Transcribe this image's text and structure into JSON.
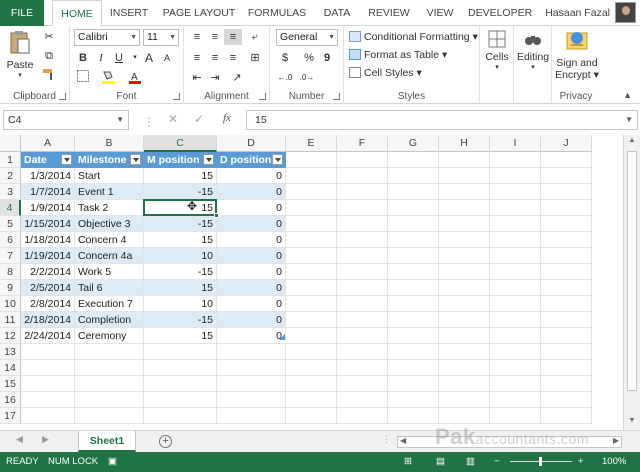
{
  "ribbon_tabs": [
    "FILE",
    "HOME",
    "INSERT",
    "PAGE LAYOUT",
    "FORMULAS",
    "DATA",
    "REVIEW",
    "VIEW",
    "DEVELOPER"
  ],
  "active_tab": "HOME",
  "user_name": "Hasaan Fazal",
  "clipboard": {
    "paste_label": "Paste",
    "group_label": "Clipboard"
  },
  "font": {
    "name": "Calibri",
    "size": "11",
    "group_label": "Font",
    "bold": "B",
    "italic": "I",
    "underline": "U",
    "grow": "A",
    "shrink": "A"
  },
  "alignment": {
    "group_label": "Alignment"
  },
  "number": {
    "format": "General",
    "currency": "$",
    "percent": "%",
    "comma": "9",
    "group_label": "Number"
  },
  "styles": {
    "conditional": "Conditional Formatting",
    "table": "Format as Table",
    "cell_styles": "Cell Styles",
    "group_label": "Styles"
  },
  "cells_label": "Cells",
  "editing_label": "Editing",
  "privacy": {
    "sign_label": "Sign and",
    "encrypt_label": "Encrypt",
    "group_label": "Privacy"
  },
  "name_box": "C4",
  "formula_value": "15",
  "fx_label": "fx",
  "columns": [
    "A",
    "B",
    "C",
    "D",
    "E",
    "F",
    "G",
    "H",
    "I",
    "J"
  ],
  "selected_column": "C",
  "row_numbers": [
    "1",
    "2",
    "3",
    "4",
    "5",
    "6",
    "7",
    "8",
    "9",
    "10",
    "11",
    "12",
    "13",
    "14",
    "15",
    "16",
    "17"
  ],
  "selected_row": "4",
  "table": {
    "headers": [
      "Date",
      "Milestone",
      "M position",
      "D position"
    ],
    "rows": [
      [
        "1/3/2014",
        "Start",
        "15",
        "0"
      ],
      [
        "1/7/2014",
        "Event 1",
        "-15",
        "0"
      ],
      [
        "1/9/2014",
        "Task 2",
        "15",
        "0"
      ],
      [
        "1/15/2014",
        "Objective 3",
        "-15",
        "0"
      ],
      [
        "1/18/2014",
        "Concern 4",
        "15",
        "0"
      ],
      [
        "1/19/2014",
        "Concern 4a",
        "10",
        "0"
      ],
      [
        "2/2/2014",
        "Work 5",
        "-15",
        "0"
      ],
      [
        "2/5/2014",
        "Tail 6",
        "15",
        "0"
      ],
      [
        "2/8/2014",
        "Execution 7",
        "10",
        "0"
      ],
      [
        "2/18/2014",
        "Completion",
        "-15",
        "0"
      ],
      [
        "2/24/2014",
        "Ceremony",
        "15",
        "0"
      ]
    ]
  },
  "sheet_tab": "Sheet1",
  "status": {
    "ready": "READY",
    "numlock": "NUM LOCK",
    "zoom": "100%"
  },
  "watermark": {
    "brand": "Pak",
    "suffix": "accountants.com"
  },
  "colors": {
    "excel_green": "#217346",
    "table_header": "#5b9bd5",
    "band": "#ddebf7"
  }
}
